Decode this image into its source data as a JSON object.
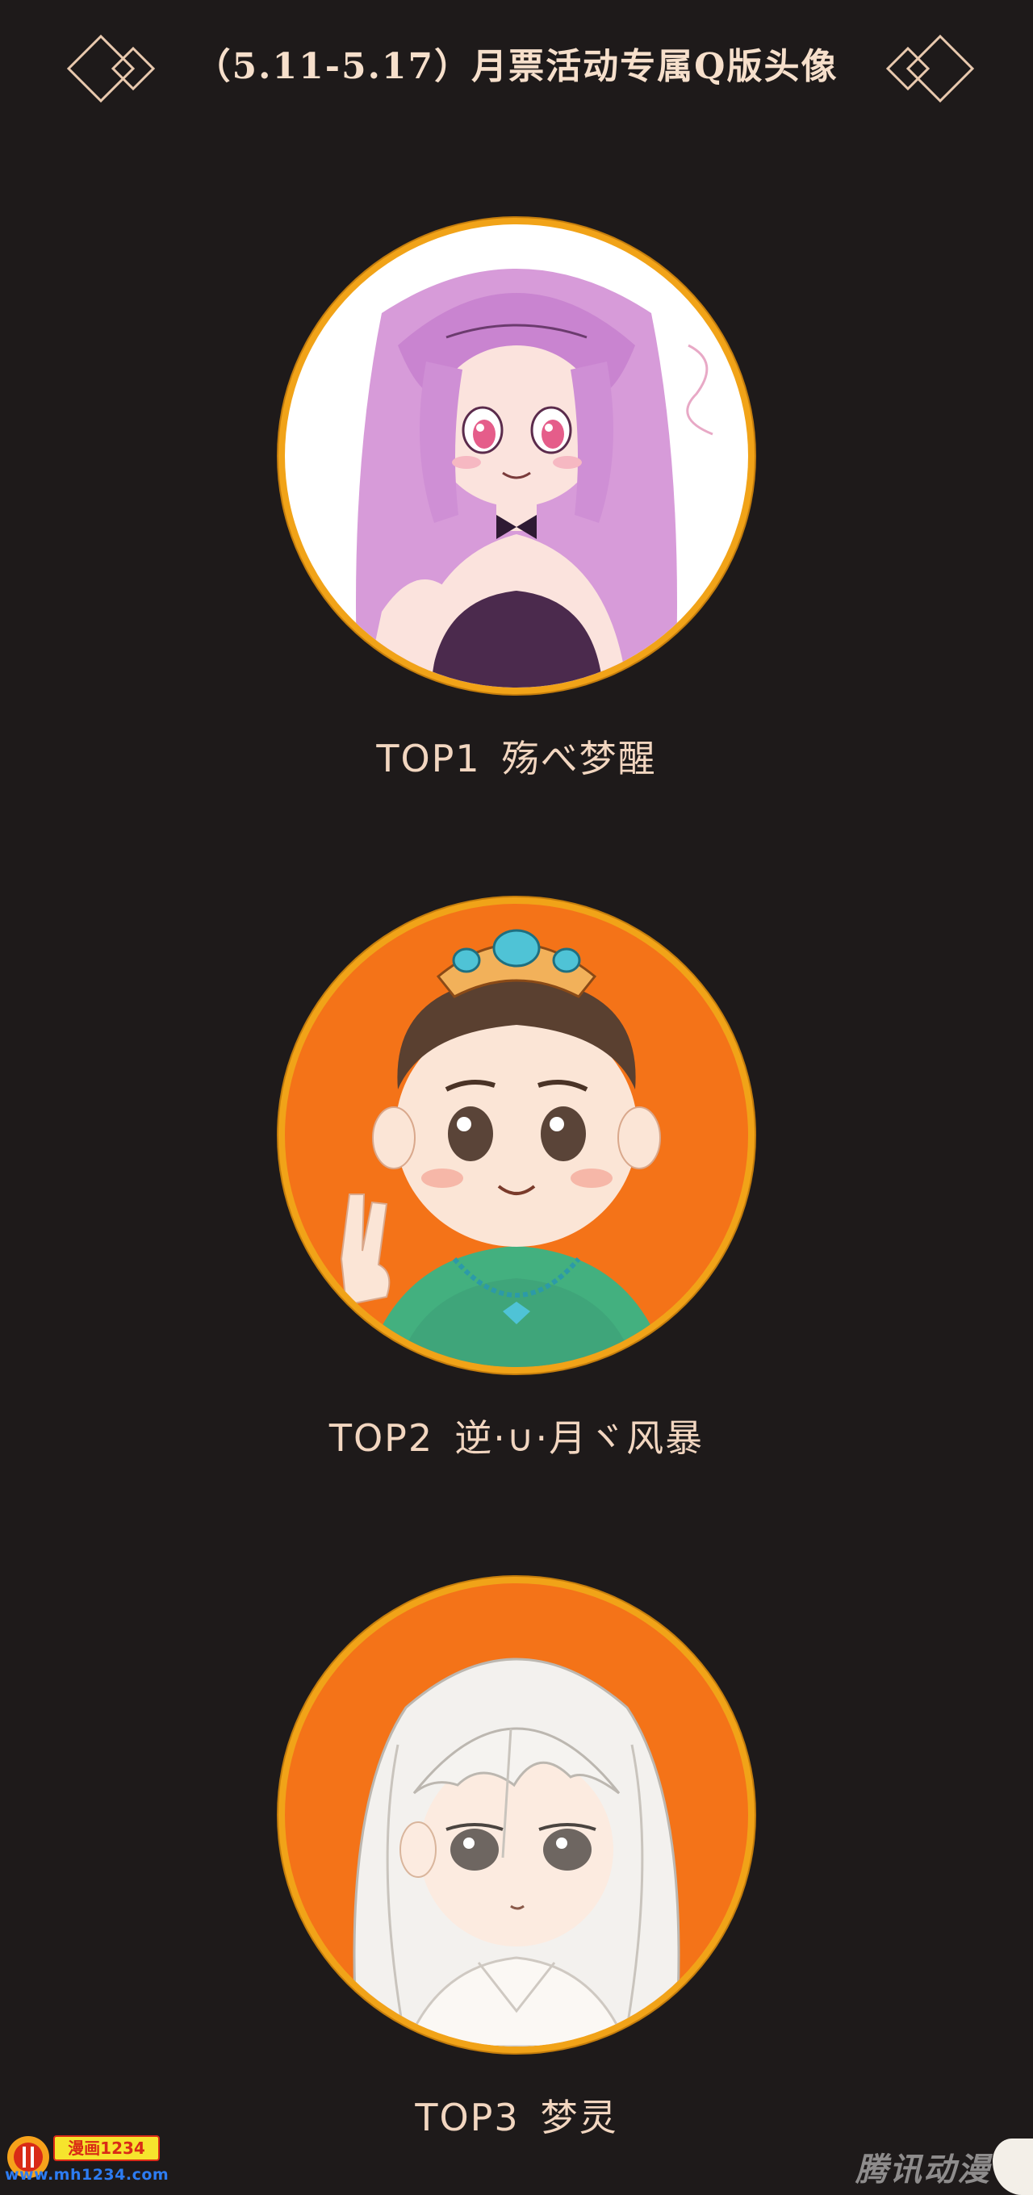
{
  "header": {
    "title": "（5.11-5.17）月票活动专属Q版头像"
  },
  "entries": [
    {
      "rank": "TOP1",
      "name": "殇べ梦醒"
    },
    {
      "rank": "TOP2",
      "name": "逆·∪·月ヾ风暴"
    },
    {
      "rank": "TOP3",
      "name": "梦灵"
    }
  ],
  "footer": {
    "site_badge": "漫画1234",
    "site_url": "www.mh1234.com",
    "watermark": "腾讯动漫"
  },
  "colors": {
    "background": "#1e1a1a",
    "ring": "#f1a318",
    "avatar1_bg": "#ffffff",
    "avatar2_bg": "#f47318",
    "avatar3_bg": "#f47318",
    "label_text": "#f2d6c0"
  },
  "icons": {
    "header_ornament": "double-diamond-ornament",
    "site_logo": "mh1234-logo"
  }
}
